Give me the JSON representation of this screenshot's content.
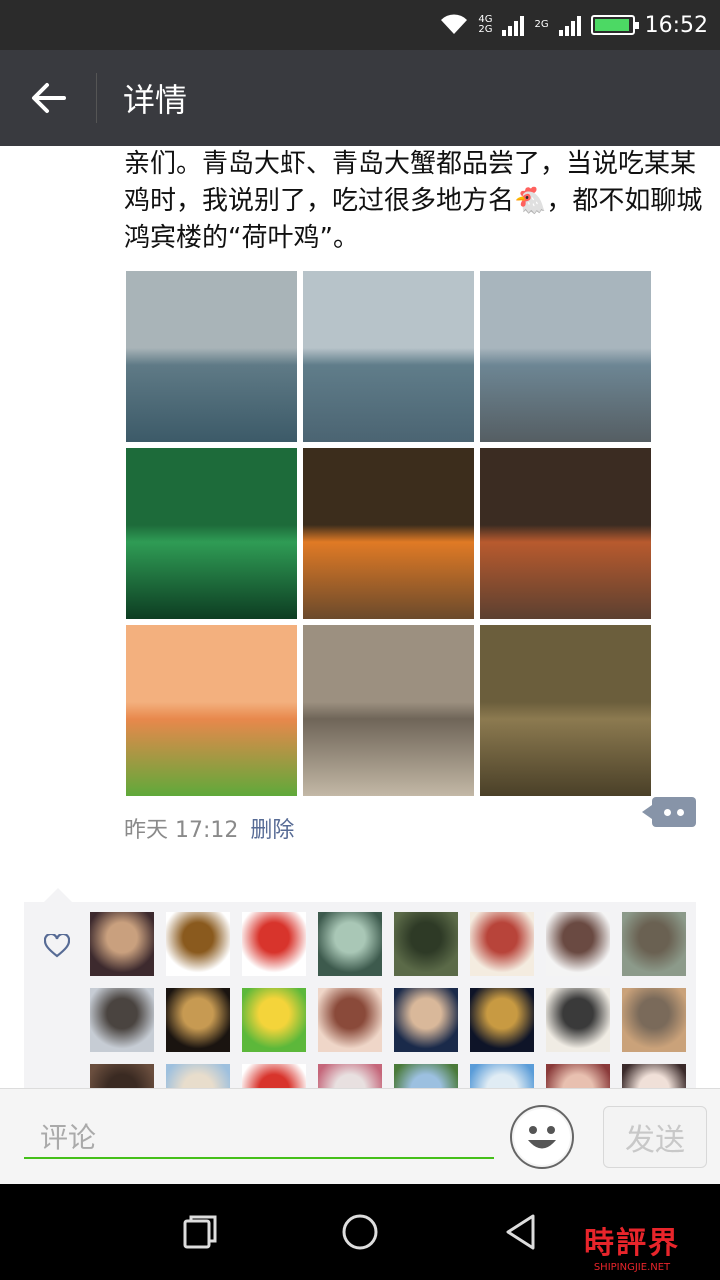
{
  "status_bar": {
    "network_top": "4G",
    "network_bottom": "2G",
    "network2": "2G",
    "time": "16:52",
    "battery_level": 0.95
  },
  "header": {
    "title": "详情",
    "back_icon": "arrow-left-icon"
  },
  "post": {
    "text": "亲们。青岛大虾、青岛大蟹都品尝了，当说吃某某鸡时，我说别了，吃过很多地方名🐔，都不如聊城鸿宾楼的“荷叶鸡”。",
    "photos": [
      {
        "name": "sea-photo-1",
        "colors": [
          "#a9b4b8",
          "#5f7a86",
          "#3c5a68"
        ]
      },
      {
        "name": "sea-photo-2",
        "colors": [
          "#b7c3c9",
          "#607d8a",
          "#4b6472"
        ]
      },
      {
        "name": "sea-photo-3",
        "colors": [
          "#a8b5bd",
          "#6d8694",
          "#555e63"
        ]
      },
      {
        "name": "subway-photo",
        "colors": [
          "#1d6b3a",
          "#2f9c55",
          "#0d3d22"
        ]
      },
      {
        "name": "crab-photo",
        "colors": [
          "#3c2d1c",
          "#e07a25",
          "#6b4a2c"
        ]
      },
      {
        "name": "crab-dish-photo",
        "colors": [
          "#3b2c22",
          "#b85a2e",
          "#5c4030"
        ]
      },
      {
        "name": "shrimp-photo",
        "colors": [
          "#f3b07e",
          "#e8884c",
          "#5fa93a"
        ]
      },
      {
        "name": "clams-photo",
        "colors": [
          "#9c9080",
          "#6f6558",
          "#c3b8a6"
        ]
      },
      {
        "name": "noodle-soup-photo",
        "colors": [
          "#6b5e3c",
          "#8c7a50",
          "#4a4028"
        ]
      }
    ],
    "time": "昨天 17:12",
    "delete_label": "删除",
    "comment_icon": "comment-icon"
  },
  "likes": {
    "heart_icon": "heart-icon",
    "avatars": [
      {
        "name": "avatar-woman",
        "colors": [
          "#3d2a2e",
          "#c9a07e"
        ]
      },
      {
        "name": "avatar-coin",
        "colors": [
          "#ffffff",
          "#8a5a1e"
        ]
      },
      {
        "name": "avatar-red-logo",
        "colors": [
          "#ffffff",
          "#d8342c"
        ]
      },
      {
        "name": "avatar-man-office",
        "colors": [
          "#3d5a4d",
          "#a9c7b6"
        ]
      },
      {
        "name": "avatar-forest",
        "colors": [
          "#5b6a48",
          "#2e3a26"
        ]
      },
      {
        "name": "avatar-calligraphy",
        "colors": [
          "#f4ece0",
          "#b8443a"
        ]
      },
      {
        "name": "avatar-woman-2",
        "colors": [
          "#f4f4f4",
          "#6a4a42"
        ]
      },
      {
        "name": "avatar-statue",
        "colors": [
          "#8c9a8a",
          "#6a6152"
        ]
      },
      {
        "name": "avatar-mountain",
        "colors": [
          "#c6ccd4",
          "#4a4440"
        ]
      },
      {
        "name": "avatar-leopard",
        "colors": [
          "#1a1410",
          "#c79a52"
        ]
      },
      {
        "name": "avatar-green-badge",
        "colors": [
          "#5cb83a",
          "#f4d43a"
        ]
      },
      {
        "name": "avatar-woman-3",
        "colors": [
          "#efd6c8",
          "#8a4a3a"
        ]
      },
      {
        "name": "avatar-man-suit",
        "colors": [
          "#1a2a4a",
          "#d9b89a"
        ]
      },
      {
        "name": "avatar-night-city",
        "colors": [
          "#0e1428",
          "#c89a42"
        ]
      },
      {
        "name": "avatar-calligraphy-2",
        "colors": [
          "#f0ece4",
          "#3a3a3a"
        ]
      },
      {
        "name": "avatar-child",
        "colors": [
          "#caa27a",
          "#7a6a5a"
        ]
      },
      {
        "name": "avatar-partial-1",
        "colors": [
          "#6a4e3e",
          "#3a2a22"
        ]
      },
      {
        "name": "avatar-partial-2",
        "colors": [
          "#9ec0de",
          "#e8ddcc"
        ]
      },
      {
        "name": "avatar-partial-3",
        "colors": [
          "#ffffff",
          "#d8342c"
        ]
      },
      {
        "name": "avatar-partial-4",
        "colors": [
          "#c5667a",
          "#e8e0e0"
        ]
      },
      {
        "name": "avatar-partial-5",
        "colors": [
          "#4a7a3a",
          "#9cc0e0"
        ]
      },
      {
        "name": "avatar-partial-6",
        "colors": [
          "#5a9cd8",
          "#e0ecf4"
        ]
      },
      {
        "name": "avatar-partial-7",
        "colors": [
          "#8a3a3a",
          "#e8c0b0"
        ]
      },
      {
        "name": "avatar-partial-8",
        "colors": [
          "#3a2a2a",
          "#f0e0d8"
        ]
      }
    ]
  },
  "comment_bar": {
    "placeholder": "评论",
    "emoji_icon": "smiley-icon",
    "send_label": "发送"
  },
  "nav_bar": {
    "recents_icon": "recents-icon",
    "home_icon": "home-icon",
    "back_icon": "nav-back-icon"
  },
  "watermark": {
    "main": "時評界",
    "sub": "SHIPINGJIE.NET"
  },
  "colors": {
    "header_bg": "#393a3f",
    "status_bg": "#2b2b2b",
    "link": "#576b95",
    "input_underline": "#45c01a",
    "watermark": "#e8252b"
  }
}
